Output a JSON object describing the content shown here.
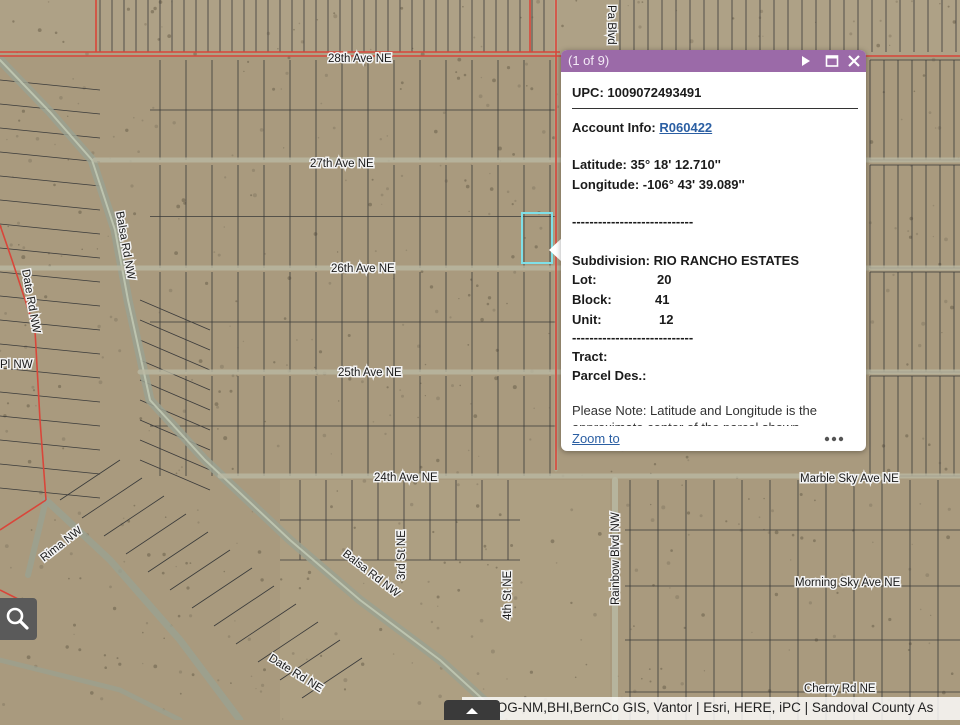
{
  "map": {
    "streets": [
      {
        "id": "28th",
        "label": "28th Ave NE"
      },
      {
        "id": "27th",
        "label": "27th Ave NE"
      },
      {
        "id": "26th",
        "label": "26th Ave NE"
      },
      {
        "id": "25th",
        "label": "25th Ave NE"
      },
      {
        "id": "24th",
        "label": "24th Ave NE"
      },
      {
        "id": "marble",
        "label": "Marble Sky Ave NE"
      },
      {
        "id": "morning",
        "label": "Morning Sky Ave NE"
      },
      {
        "id": "cherry",
        "label": "Cherry Rd NE"
      },
      {
        "id": "balsa-n",
        "label": "Balsa Rd NW"
      },
      {
        "id": "balsa-s",
        "label": "Balsa Rd NW"
      },
      {
        "id": "date-n",
        "label": "Date Rd NW"
      },
      {
        "id": "date-s",
        "label": "Date Rd NE"
      },
      {
        "id": "rima",
        "label": "Rima NW"
      },
      {
        "id": "third",
        "label": "3rd St NE"
      },
      {
        "id": "fourth",
        "label": "4th St NE"
      },
      {
        "id": "rainbow",
        "label": "Rainbow Blvd NW"
      },
      {
        "id": "pl",
        "label": "Pl NW"
      },
      {
        "id": "top",
        "label": "Pa Blvd"
      }
    ],
    "colors": {
      "imagery": "#a99a7e",
      "parcel_line": "#3a3a3a",
      "road": "#9aa191",
      "boundary": "#d9463a",
      "selection": "#7fe0e8"
    }
  },
  "popup": {
    "counter": "(1 of 9)",
    "header_color": "#9b6aa8",
    "upc": "UPC: 1009072493491",
    "account_label": "Account Info:",
    "account_value": "R060422",
    "latitude": "Latitude: 35° 18' 12.710''",
    "longitude": "Longitude: -106° 43' 39.089''",
    "separator": "----------------------------",
    "subdivision": "Subdivision: RIO RANCHO ESTATES",
    "lot_label": "Lot:",
    "lot_value": "20",
    "block_label": "Block:",
    "block_value": "41",
    "unit_label": "Unit:",
    "unit_value": "12",
    "tract": "Tract:",
    "parcel_des": "Parcel Des.:",
    "note": "Please Note: Latitude and Longitude is the approximate center of the parcel shown.",
    "zoom_to": "Zoom to",
    "icons": [
      "play-icon",
      "maximize-icon",
      "close-icon",
      "more-icon"
    ]
  },
  "attribution": "MRCOG-NM,BHI,BernCo GIS, Vantor | Esri, HERE, iPC | Sandoval County As",
  "search_icon": "search-icon"
}
